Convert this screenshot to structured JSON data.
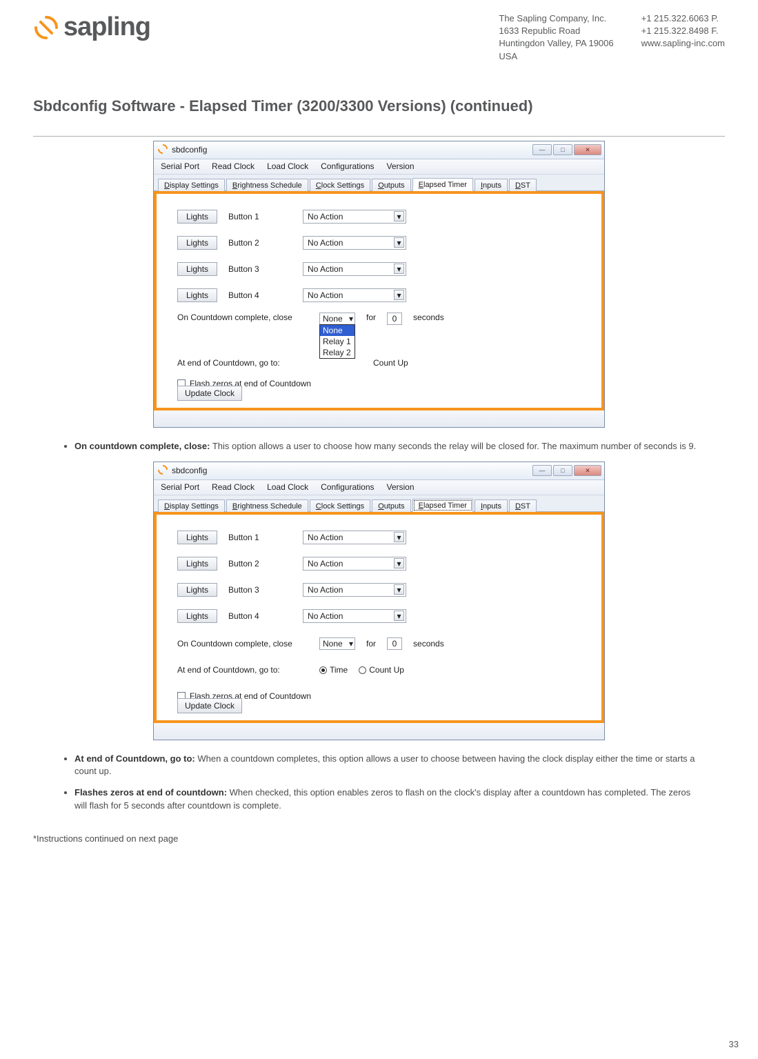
{
  "header": {
    "brand": "sapling",
    "company_block": {
      "l1": "The Sapling Company, Inc.",
      "l2": "1633 Republic Road",
      "l3": "Huntingdon Valley, PA 19006",
      "l4": "USA"
    },
    "contact_block": {
      "l1": "+1 215.322.6063 P.",
      "l2": "+1 215.322.8498 F.",
      "l3": "www.sapling-inc.com"
    }
  },
  "section_title": "Sbdconfig Software - Elapsed Timer (3200/3300 Versions) (continued)",
  "app": {
    "title": "sbdconfig",
    "menus": [
      "Serial Port",
      "Read Clock",
      "Load Clock",
      "Configurations",
      "Version"
    ],
    "tabs": [
      "Display Settings",
      "Brightness Schedule",
      "Clock Settings",
      "Outputs",
      "Elapsed Timer",
      "Inputs",
      "DST"
    ],
    "active_tab": "Elapsed Timer",
    "lights_btn": "Lights",
    "buttons": [
      "Button 1",
      "Button 2",
      "Button 3",
      "Button 4"
    ],
    "action_value": "No Action",
    "row_close_label": "On Countdown complete, close",
    "close_relay_value": "None",
    "close_for": "for",
    "close_secs_value": "0",
    "close_seconds": "seconds",
    "row_goto_label": "At end of Countdown, go to:",
    "goto_countup": "Count Up",
    "goto_time": "Time",
    "relay_options": [
      "None",
      "Relay 1",
      "Relay 2"
    ],
    "flash_label": "Flash zeros at end of Countdown",
    "update_btn": "Update Clock"
  },
  "bullets": {
    "b1_title": "On countdown complete, close:",
    "b1_text": " This option allows a user to choose how many seconds the relay will be closed for. The maximum number of seconds is 9.",
    "b2_title": "At end of Countdown, go to:",
    "b2_text": " When a countdown completes, this option allows a user to choose between having the clock display either the time or starts a count up.",
    "b3_title": "Flashes zeros at end of countdown:",
    "b3_text": " When checked, this option enables zeros to flash on the clock's display after a countdown has completed. The zeros will flash for 5 seconds after countdown is complete."
  },
  "footnote": "*Instructions continued on next page",
  "page_number": "33"
}
